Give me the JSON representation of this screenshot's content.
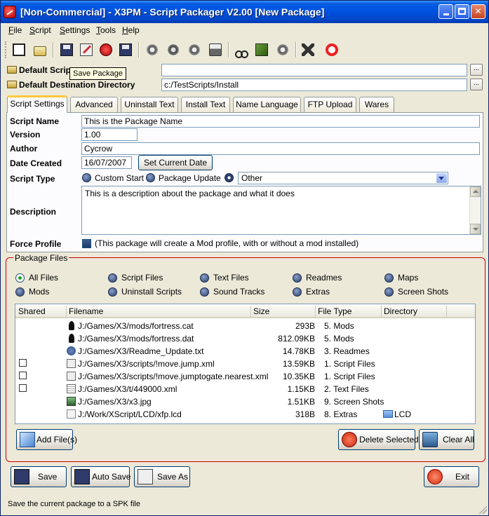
{
  "window": {
    "title": "[Non-Commercial] - X3PM - Script Packager V2.00 [New Package]",
    "minimize_label": "",
    "maximize_label": "",
    "close_label": "✕"
  },
  "menu": {
    "file": {
      "first": "F",
      "rest": "ile"
    },
    "script": {
      "first": "S",
      "rest": "cript"
    },
    "settings": {
      "first": "S",
      "rest": "ettings"
    },
    "tools": {
      "first": "T",
      "rest": "ools"
    },
    "help": {
      "first": "H",
      "rest": "elp"
    }
  },
  "toolbar": {
    "tooltip": "Save Package"
  },
  "dirs": {
    "script_dir_label": "Default Script Directory",
    "script_dir_label_visible": "Default Scrip",
    "script_dir_value": "",
    "dest_dir_label": "Default Destination Directory",
    "dest_dir_value": "c:/TestScripts/Install",
    "browse_label": "..."
  },
  "tabs": [
    {
      "label": "Script Settings"
    },
    {
      "label": "Advanced"
    },
    {
      "label": "Uninstall Text"
    },
    {
      "label": "Install Text"
    },
    {
      "label": "Name Language"
    },
    {
      "label": "FTP Upload"
    },
    {
      "label": "Wares"
    }
  ],
  "script_settings": {
    "name_label": "Script Name",
    "name_value": "This is the Package Name",
    "version_label": "Version",
    "version_value": "1.00",
    "author_label": "Author",
    "author_value": "Cycrow",
    "date_label": "Date Created",
    "date_value": "16/07/2007",
    "set_date_button": "Set Current Date",
    "type_label": "Script Type",
    "type_options": [
      "Custom Start",
      "Package Update"
    ],
    "type_combo_value": "Other",
    "description_label": "Description",
    "description_value": "This is a description about the package and what it does",
    "force_profile_label": "Force Profile",
    "force_profile_text": "(This package will create a Mod profile, with or without a mod installed)"
  },
  "package_files": {
    "group_title": "Package Files",
    "filters": [
      {
        "label": "All Files",
        "selected": true
      },
      {
        "label": "Script Files"
      },
      {
        "label": "Text Files"
      },
      {
        "label": "Readmes"
      },
      {
        "label": "Maps"
      },
      {
        "label": "Mods"
      },
      {
        "label": "Uninstall Scripts"
      },
      {
        "label": "Sound Tracks"
      },
      {
        "label": "Extras"
      },
      {
        "label": "Screen Shots"
      }
    ],
    "columns": [
      "Shared",
      "Filename",
      "Size",
      "File Type",
      "Directory"
    ],
    "rows": [
      {
        "shared": null,
        "icon": "cat-file-icon",
        "filename": "J:/Games/X3/mods/fortress.cat",
        "size": "293B",
        "type": "5. Mods",
        "dir": ""
      },
      {
        "shared": null,
        "icon": "dat-file-icon",
        "filename": "J:/Games/X3/mods/fortress.dat",
        "size": "812.09KB",
        "type": "5. Mods",
        "dir": ""
      },
      {
        "shared": null,
        "icon": "info-file-icon",
        "filename": "J:/Games/X3/Readme_Update.txt",
        "size": "14.78KB",
        "type": "3. Readmes",
        "dir": ""
      },
      {
        "shared": false,
        "icon": "xml-file-icon",
        "filename": "J:/Games/X3/scripts/!move.jump.xml",
        "size": "13.59KB",
        "type": "1. Script Files",
        "dir": ""
      },
      {
        "shared": false,
        "icon": "xml-file-icon",
        "filename": "J:/Games/X3/scripts/!move.jumptogate.nearest.xml",
        "size": "10.35KB",
        "type": "1. Script Files",
        "dir": ""
      },
      {
        "shared": false,
        "icon": "text-file-icon",
        "filename": "J:/Games/X3/t/449000.xml",
        "size": "1.15KB",
        "type": "2. Text Files",
        "dir": ""
      },
      {
        "shared": null,
        "icon": "image-file-icon",
        "filename": "J:/Games/X3/x3.jpg",
        "size": "1.51KB",
        "type": "9. Screen Shots",
        "dir": ""
      },
      {
        "shared": null,
        "icon": "lcd-file-icon",
        "filename": "J:/Work/XScript/LCD/xfp.lcd",
        "size": "318B",
        "type": "8. Extras",
        "dir": "LCD"
      }
    ],
    "add_button": "Add File(s)",
    "delete_button": "Delete Selected",
    "clear_button": "Clear All"
  },
  "bottom": {
    "save": "Save",
    "auto_save": "Auto Save",
    "save_as": "Save As",
    "exit": "Exit"
  },
  "status": {
    "text": "Save the current package to a SPK file"
  }
}
